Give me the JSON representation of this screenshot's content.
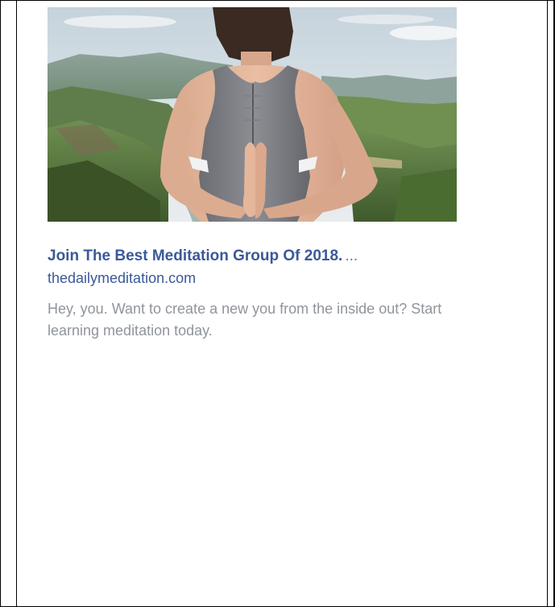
{
  "ad": {
    "image": {
      "subject": "woman-reverse-prayer-pose",
      "scene": "mountain-valley-landscape"
    },
    "title": "Join The Best Meditation Group Of 2018.",
    "ellipsis": "...",
    "domain": "thedailymeditation.com",
    "description": "Hey, you. Want to create a new you from the inside out? Start learning meditation today.",
    "colors": {
      "title": "#3b5998",
      "domain": "#3b5998",
      "description": "#90949c"
    }
  }
}
